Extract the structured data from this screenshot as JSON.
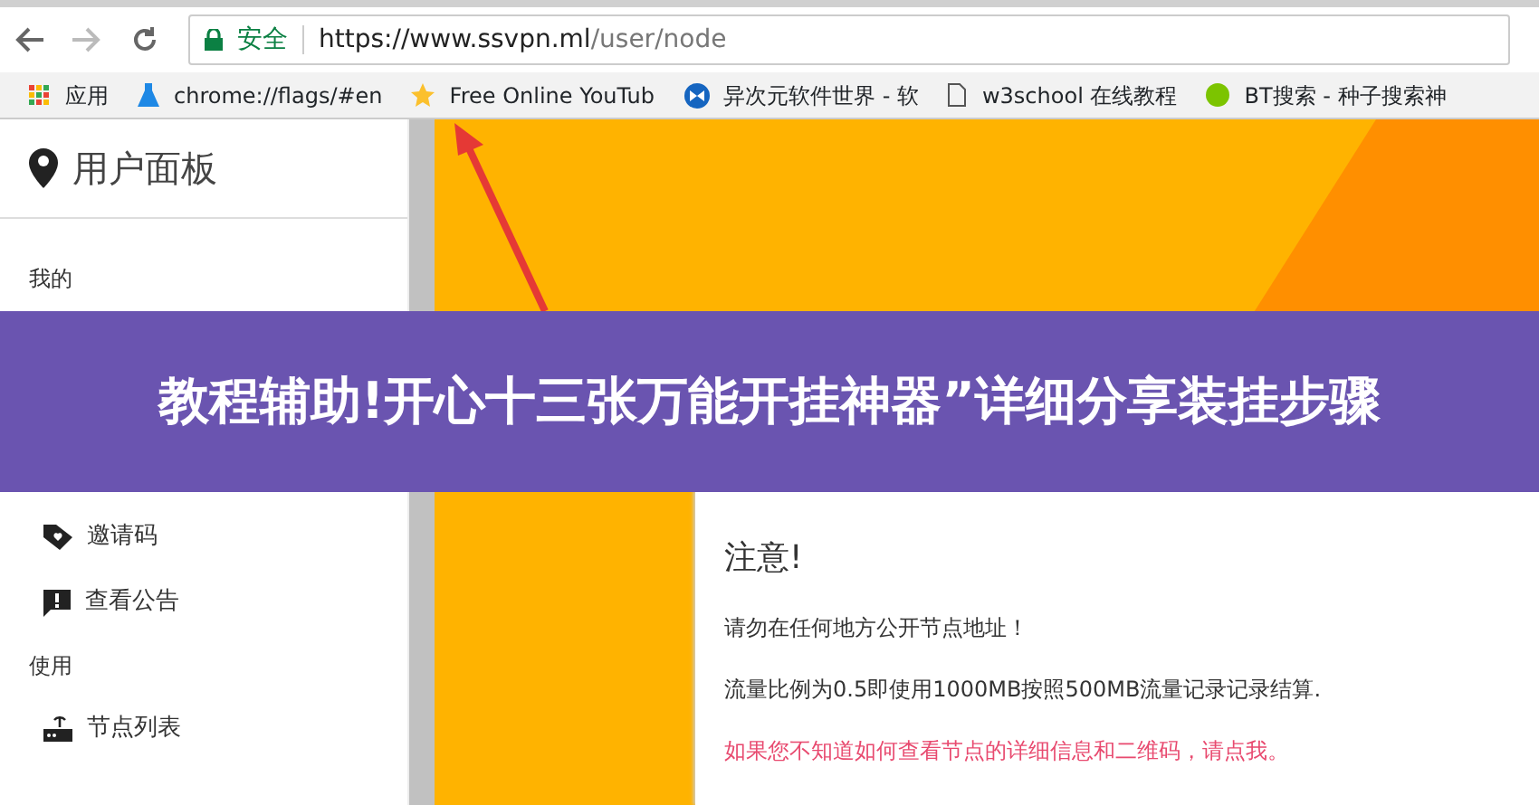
{
  "browser": {
    "security_label": "安全",
    "url_host": "https://www.ssvpn.ml",
    "url_path": "/user/node",
    "bookmarks": [
      {
        "kind": "apps",
        "label": "应用"
      },
      {
        "kind": "flask",
        "label": "chrome://flags/#en"
      },
      {
        "kind": "star",
        "label": "Free Online YouTub"
      },
      {
        "kind": "bowtie",
        "label": "异次元软件世界 - 软"
      },
      {
        "kind": "page",
        "label": "w3school 在线教程"
      },
      {
        "kind": "dot",
        "label": "BT搜索 - 种子搜索神"
      }
    ]
  },
  "sidebar": {
    "title": "用户面板",
    "sections": [
      {
        "heading": "我的",
        "items": [
          {
            "kind": "tag",
            "label": "邀请码"
          },
          {
            "kind": "alert",
            "label": "查看公告"
          }
        ]
      },
      {
        "heading": "使用",
        "items": [
          {
            "kind": "router",
            "label": "节点列表"
          }
        ]
      }
    ]
  },
  "notice": {
    "title": "注意!",
    "lines": [
      {
        "kind": "plain",
        "text": "请勿在任何地方公开节点地址！"
      },
      {
        "kind": "plain",
        "text": "流量比例为0.5即使用1000MB按照500MB流量记录记录结算."
      },
      {
        "kind": "link",
        "text": "如果您不知道如何查看节点的详细信息和二维码，请点我。"
      }
    ]
  },
  "banner": {
    "title": "教程辅助!开心十三张万能开挂神器”详细分享装挂步骤"
  }
}
